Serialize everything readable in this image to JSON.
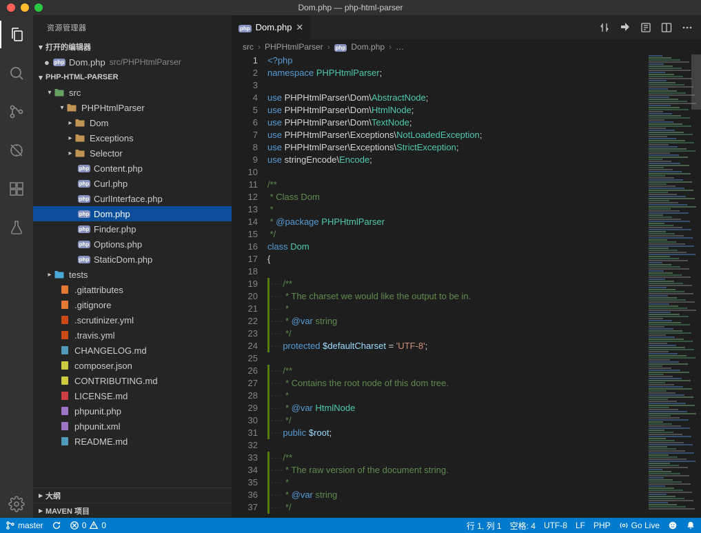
{
  "window": {
    "title": "Dom.php — php-html-parser"
  },
  "sidebar": {
    "title": "资源管理器",
    "open_editors_label": "打开的编辑器",
    "open_editors": [
      {
        "name": "Dom.php",
        "path": "src/PHPHtmlParser",
        "dirty": true
      }
    ],
    "workspace": "PHP-HTML-PARSER",
    "outline_label": "大纲",
    "maven_label": "MAVEN 项目"
  },
  "tree": {
    "src": "src",
    "phphtmlparser": "PHPHtmlParser",
    "folders": {
      "dom": "Dom",
      "exceptions": "Exceptions",
      "selector": "Selector"
    },
    "php_files": [
      "Content.php",
      "Curl.php",
      "CurlInterface.php",
      "Dom.php",
      "Finder.php",
      "Options.php",
      "StaticDom.php"
    ],
    "tests": "tests",
    "root_files": [
      {
        "n": ".gitattributes",
        "c": "#e37933"
      },
      {
        "n": ".gitignore",
        "c": "#e37933"
      },
      {
        "n": ".scrutinizer.yml",
        "c": "#cb4b16"
      },
      {
        "n": ".travis.yml",
        "c": "#cb4b16"
      },
      {
        "n": "CHANGELOG.md",
        "c": "#519aba"
      },
      {
        "n": "composer.json",
        "c": "#cbcb41"
      },
      {
        "n": "CONTRIBUTING.md",
        "c": "#cbcb41"
      },
      {
        "n": "LICENSE.md",
        "c": "#cc3e44"
      },
      {
        "n": "phpunit.php",
        "c": "#a074c4"
      },
      {
        "n": "phpunit.xml",
        "c": "#a074c4"
      },
      {
        "n": "README.md",
        "c": "#519aba"
      }
    ]
  },
  "tab": {
    "label": "Dom.php"
  },
  "breadcrumbs": {
    "a": "src",
    "b": "PHPHtmlParser",
    "c": "Dom.php",
    "d": "…"
  },
  "status": {
    "branch": "master",
    "errors": "0",
    "warnings": "0",
    "ln_col": "行 1, 列 1",
    "spaces": "空格: 4",
    "encoding": "UTF-8",
    "eol": "LF",
    "lang": "PHP",
    "live": "Go Live"
  },
  "code": {
    "lines": [
      {
        "n": 1,
        "html": "<span class='php-open'>&lt;?php</span>"
      },
      {
        "n": 2,
        "html": "<span class='kw'>namespace</span> <span class='cls'>PHPHtmlParser</span><span class='punc'>;</span>"
      },
      {
        "n": 3,
        "html": ""
      },
      {
        "n": 4,
        "html": "<span class='kw'>use</span> PHPHtmlParser\\Dom\\<span class='cls'>AbstractNode</span><span class='punc'>;</span>"
      },
      {
        "n": 5,
        "html": "<span class='kw'>use</span> PHPHtmlParser\\Dom\\<span class='cls'>HtmlNode</span><span class='punc'>;</span>"
      },
      {
        "n": 6,
        "html": "<span class='kw'>use</span> PHPHtmlParser\\Dom\\<span class='cls'>TextNode</span><span class='punc'>;</span>"
      },
      {
        "n": 7,
        "html": "<span class='kw'>use</span> PHPHtmlParser\\Exceptions\\<span class='cls'>NotLoadedException</span><span class='punc'>;</span>"
      },
      {
        "n": 8,
        "html": "<span class='kw'>use</span> PHPHtmlParser\\Exceptions\\<span class='cls'>StrictException</span><span class='punc'>;</span>"
      },
      {
        "n": 9,
        "html": "<span class='kw'>use</span> stringEncode\\<span class='cls'>Encode</span><span class='punc'>;</span>"
      },
      {
        "n": 10,
        "html": ""
      },
      {
        "n": 11,
        "html": "<span class='com'>/**</span>"
      },
      {
        "n": 12,
        "html": "<span class='com'> * Class Dom</span>"
      },
      {
        "n": 13,
        "html": "<span class='com'> *</span>"
      },
      {
        "n": 14,
        "html": "<span class='com'> * <span class='tagann'>@package</span> <span class='cls'>PHPHtmlParser</span></span>"
      },
      {
        "n": 15,
        "html": "<span class='com'> */</span>"
      },
      {
        "n": 16,
        "html": "<span class='kw'>class</span> <span class='cls'>Dom</span>"
      },
      {
        "n": 17,
        "html": "<span class='punc'>{</span>"
      },
      {
        "n": 18,
        "html": ""
      },
      {
        "n": 19,
        "html": "<span class='ws'>····</span><span class='com'>/**</span>",
        "bar": true
      },
      {
        "n": 20,
        "html": "<span class='ws'>····</span><span class='com'> * The charset we would like the output to be in.</span>",
        "bar": true
      },
      {
        "n": 21,
        "html": "<span class='ws'>····</span><span class='com'> *</span>",
        "bar": true
      },
      {
        "n": 22,
        "html": "<span class='ws'>····</span><span class='com'> * <span class='tagann'>@var</span> string</span>",
        "bar": true
      },
      {
        "n": 23,
        "html": "<span class='ws'>····</span><span class='com'> */</span>",
        "bar": true
      },
      {
        "n": 24,
        "html": "<span class='ws'>····</span><span class='kw'>protected</span> <span class='var'>$defaultCharset</span> <span class='punc'>=</span> <span class='str'>'UTF-8'</span><span class='punc'>;</span>",
        "bar": true
      },
      {
        "n": 25,
        "html": ""
      },
      {
        "n": 26,
        "html": "<span class='ws'>····</span><span class='com'>/**</span>",
        "bar": true
      },
      {
        "n": 27,
        "html": "<span class='ws'>····</span><span class='com'> * Contains the root node of this dom tree.</span>",
        "bar": true
      },
      {
        "n": 28,
        "html": "<span class='ws'>····</span><span class='com'> *</span>",
        "bar": true
      },
      {
        "n": 29,
        "html": "<span class='ws'>····</span><span class='com'> * <span class='tagann'>@var</span> <span class='cls'>HtmlNode</span></span>",
        "bar": true
      },
      {
        "n": 30,
        "html": "<span class='ws'>····</span><span class='com'> */</span>",
        "bar": true
      },
      {
        "n": 31,
        "html": "<span class='ws'>····</span><span class='kw'>public</span> <span class='var'>$root</span><span class='punc'>;</span>",
        "bar": true
      },
      {
        "n": 32,
        "html": ""
      },
      {
        "n": 33,
        "html": "<span class='ws'>····</span><span class='com'>/**</span>",
        "bar": true
      },
      {
        "n": 34,
        "html": "<span class='ws'>····</span><span class='com'> * The raw version of the document string.</span>",
        "bar": true
      },
      {
        "n": 35,
        "html": "<span class='ws'>····</span><span class='com'> *</span>",
        "bar": true
      },
      {
        "n": 36,
        "html": "<span class='ws'>····</span><span class='com'> * <span class='tagann'>@var</span> string</span>",
        "bar": true
      },
      {
        "n": 37,
        "html": "<span class='ws'>····</span><span class='com'> */</span>",
        "bar": true
      }
    ]
  }
}
